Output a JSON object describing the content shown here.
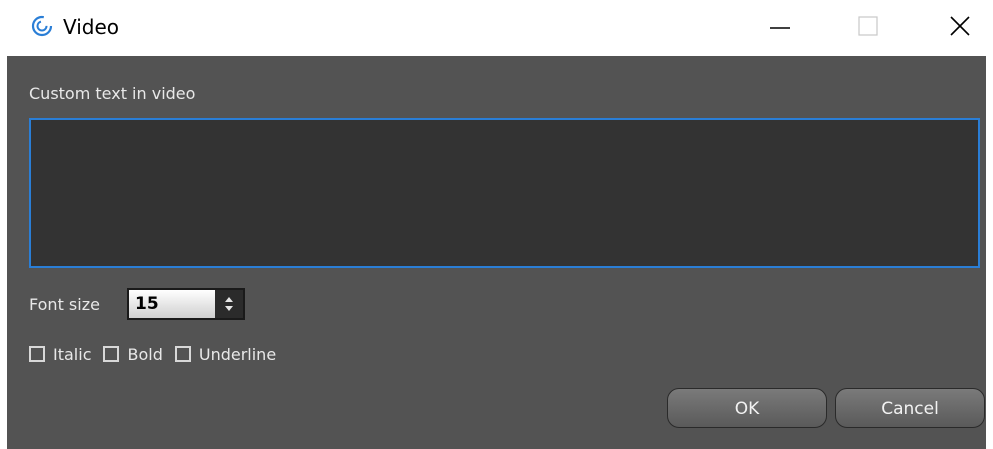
{
  "window": {
    "title": "Video",
    "controls": [
      "minimize",
      "maximize",
      "close"
    ]
  },
  "form": {
    "custom_text_label": "Custom text in video",
    "custom_text_value": "",
    "font_size_label": "Font size",
    "font_size_value": "15",
    "checkboxes": [
      {
        "label": "Italic",
        "checked": false
      },
      {
        "label": "Bold",
        "checked": false
      },
      {
        "label": "Underline",
        "checked": false
      }
    ]
  },
  "buttons": {
    "ok": "OK",
    "cancel": "Cancel"
  },
  "colors": {
    "panel_bg": "#535353",
    "input_bg": "#333333",
    "focus_border": "#2a7ed6",
    "app_icon": "#2a7ed6"
  }
}
